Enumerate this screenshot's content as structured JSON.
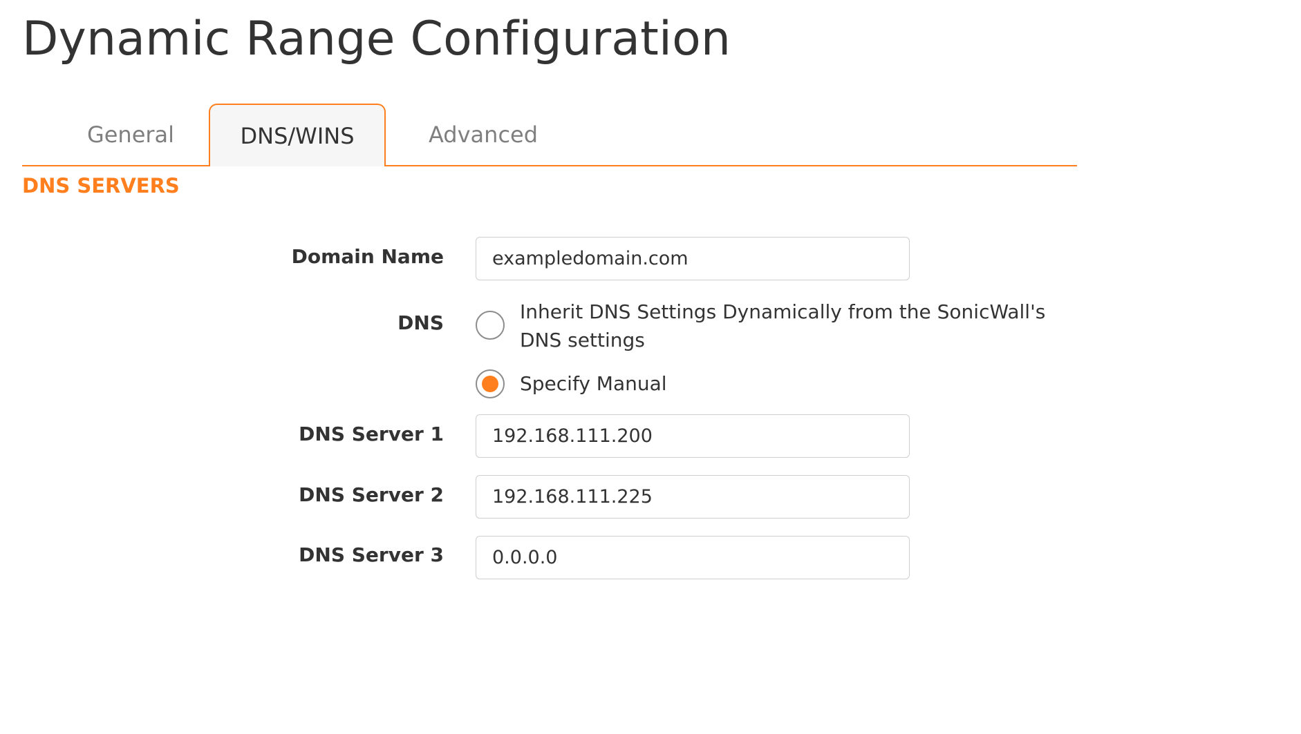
{
  "page": {
    "title": "Dynamic Range Configuration"
  },
  "tabs": [
    {
      "label": "General",
      "active": false
    },
    {
      "label": "DNS/WINS",
      "active": true
    },
    {
      "label": "Advanced",
      "active": false
    }
  ],
  "section": {
    "header": "DNS SERVERS"
  },
  "form": {
    "domain_name": {
      "label": "Domain Name",
      "value": "exampledomain.com"
    },
    "dns": {
      "label": "DNS",
      "options": [
        {
          "label": "Inherit DNS Settings Dynamically from the SonicWall's DNS settings",
          "selected": false
        },
        {
          "label": "Specify Manual",
          "selected": true
        }
      ]
    },
    "dns_server_1": {
      "label": "DNS Server 1",
      "value": "192.168.111.200"
    },
    "dns_server_2": {
      "label": "DNS Server 2",
      "value": "192.168.111.225"
    },
    "dns_server_3": {
      "label": "DNS Server 3",
      "value": "0.0.0.0"
    }
  },
  "colors": {
    "accent": "#ff7f1e",
    "text": "#333333",
    "tab_inactive_text": "#7f7f7f",
    "tab_active_bg": "#f6f6f6",
    "input_border": "#cfcfcf"
  },
  "icons": {
    "dns_inherit_radio": "radio-unchecked-icon",
    "dns_manual_radio": "radio-checked-icon"
  }
}
